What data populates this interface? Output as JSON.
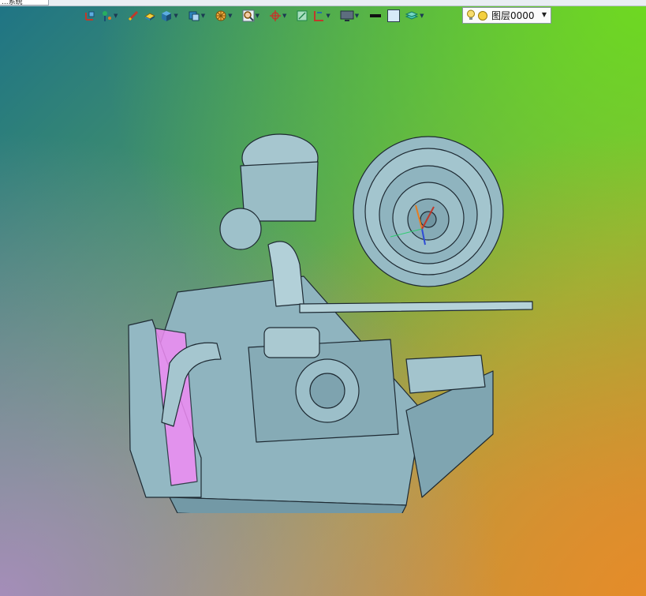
{
  "window": {
    "tab_label": "...系统"
  },
  "toolbar": {
    "layer_selector": {
      "value": "图层0000"
    },
    "icons": [
      "ucs-icon",
      "pin-icon",
      "sketch-icon",
      "solid-icon",
      "box-icon",
      "view-cube-icon",
      "render-icon",
      "zoom-icon",
      "axis-icon",
      "section-icon",
      "dimension-icon",
      "display-icon",
      "line-color-icon",
      "fill-color-icon",
      "layer-stack-icon",
      "lightbulb-icon",
      "layer-visible-icon"
    ]
  },
  "colors": {
    "viewport_top_left": "#1f7485",
    "viewport_top_right": "#6ed21e",
    "viewport_bottom_left": "#a88cbe",
    "viewport_bottom_right": "#e68c28",
    "model_body": "#8fb4bf",
    "model_edges": "#1e2a33",
    "highlight": "#f08cf5"
  }
}
